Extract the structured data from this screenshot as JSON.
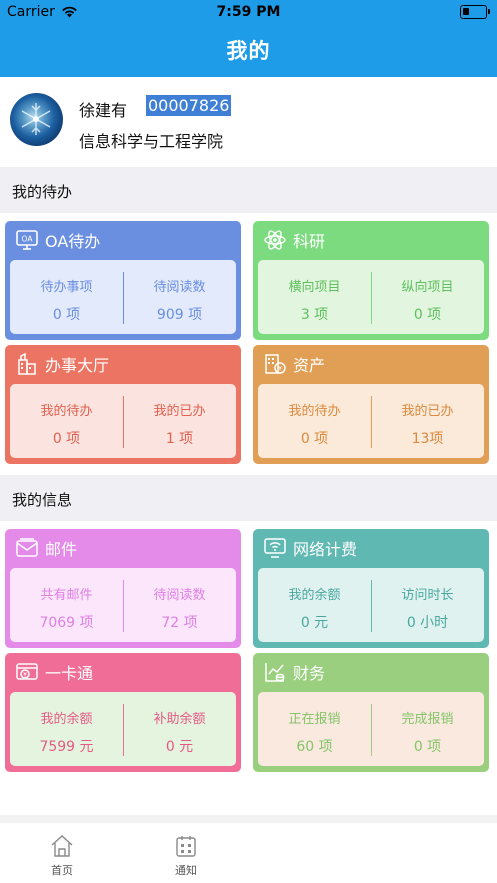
{
  "status_bar": {
    "carrier": "Carrier",
    "time": "7:59 PM"
  },
  "nav": {
    "title": "我的"
  },
  "profile": {
    "name": "徐建有",
    "id": "00007826",
    "department": "信息科学与工程学院"
  },
  "sections": {
    "todo": "我的待办",
    "info": "我的信息"
  },
  "cards": {
    "oa": {
      "title": "OA待办",
      "icon": "oa-icon",
      "left_label": "待办事项",
      "left_value": "0 项",
      "right_label": "待阅读数",
      "right_value": "909 项",
      "color": "#6a8ee0"
    },
    "research": {
      "title": "科研",
      "icon": "atom-icon",
      "left_label": "横向项目",
      "left_value": "3 项",
      "right_label": "纵向项目",
      "right_value": "0 项",
      "color": "#7cdb7f"
    },
    "hall": {
      "title": "办事大厅",
      "icon": "building-icon",
      "left_label": "我的待办",
      "left_value": "0 项",
      "right_label": "我的已办",
      "right_value": "1 项",
      "color": "#eb7462"
    },
    "assets": {
      "title": "资产",
      "icon": "asset-icon",
      "left_label": "我的待办",
      "left_value": "0 项",
      "right_label": "我的已办",
      "right_value": "13项",
      "color": "#e19e55"
    },
    "mail": {
      "title": "邮件",
      "icon": "mail-icon",
      "left_label": "共有邮件",
      "left_value": "7069 项",
      "right_label": "待阅读数",
      "right_value": "72 项",
      "color": "#e48ae8"
    },
    "network": {
      "title": "网络计费",
      "icon": "wifi-monitor-icon",
      "left_label": "我的余额",
      "left_value": "0 元",
      "right_label": "访问时长",
      "right_value": "0 小时",
      "color": "#5fb9b2"
    },
    "card": {
      "title": "一卡通",
      "icon": "yuan-card-icon",
      "left_label": "我的余额",
      "left_value": "7599 元",
      "right_label": "补助余额",
      "right_value": "0 元",
      "color": "#ef6d97"
    },
    "finance": {
      "title": "财务",
      "icon": "finance-chart-icon",
      "left_label": "正在报销",
      "left_value": "60 项",
      "right_label": "完成报销",
      "right_value": "0 项",
      "color": "#99cf7e"
    }
  },
  "tabbar": {
    "home": {
      "label": "首页",
      "icon": "home-icon"
    },
    "notice": {
      "label": "通知",
      "icon": "notice-icon"
    }
  }
}
